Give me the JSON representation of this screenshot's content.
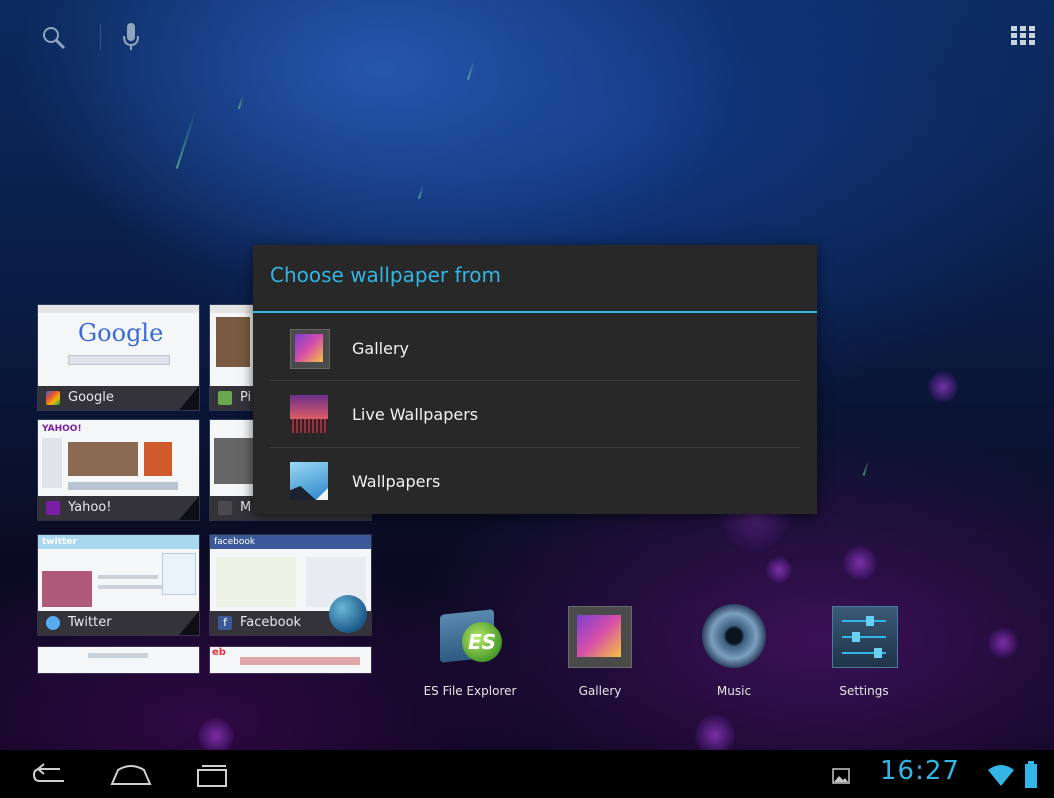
{
  "top_bar": {
    "search_icon": "search-icon",
    "mic_icon": "mic-icon",
    "apps_icon": "apps-grid-icon"
  },
  "widgets": [
    {
      "label": "Google",
      "logo": "Google"
    },
    {
      "label": "Pi"
    },
    {
      "label": "Yahoo!",
      "logo": "YAHOO!"
    },
    {
      "label": "M"
    },
    {
      "label": "Twitter",
      "logo": "twitter"
    },
    {
      "label": "Facebook",
      "logo": "facebook"
    },
    {
      "label": "eb"
    }
  ],
  "dialog": {
    "title": "Choose wallpaper from",
    "options": [
      {
        "label": "Gallery",
        "icon": "gallery-icon"
      },
      {
        "label": "Live Wallpapers",
        "icon": "live-wallpapers-icon"
      },
      {
        "label": "Wallpapers",
        "icon": "wallpapers-icon"
      }
    ]
  },
  "dock": [
    {
      "label": "ES File Explorer",
      "icon": "es-file-explorer-icon"
    },
    {
      "label": "Gallery",
      "icon": "gallery-icon"
    },
    {
      "label": "Music",
      "icon": "music-icon"
    },
    {
      "label": "Settings",
      "icon": "settings-icon"
    }
  ],
  "status_bar": {
    "time": "16:27",
    "colors": {
      "accent": "#33b5e5",
      "dialog_bg": "#282828"
    }
  }
}
